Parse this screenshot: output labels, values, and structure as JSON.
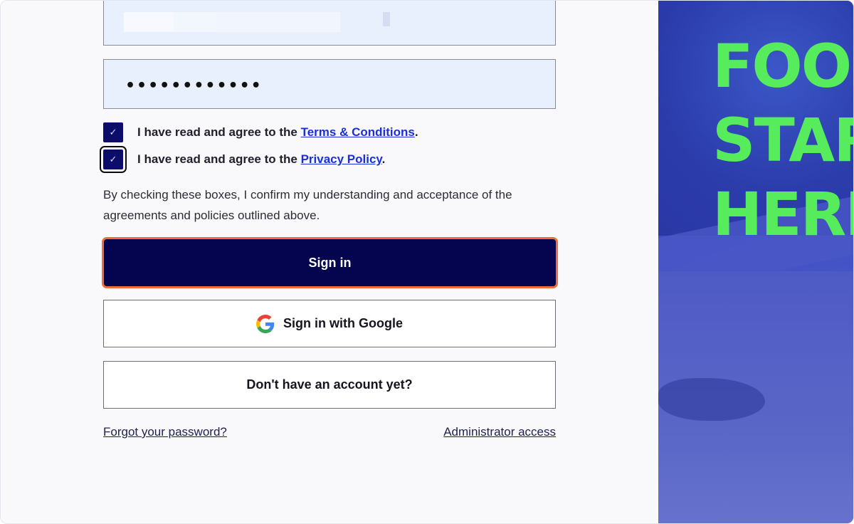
{
  "login": {
    "password_mask": "••••••••••••",
    "terms": {
      "prefix": "I have read and agree to the ",
      "link": "Terms & Conditions",
      "suffix": "."
    },
    "privacy": {
      "prefix": "I have read and agree to the ",
      "link": "Privacy Policy",
      "suffix": "."
    },
    "notice": "By checking these boxes, I confirm my understanding and acceptance of the agreements and policies outlined above.",
    "signin_label": "Sign in",
    "google_label": "Sign in with Google",
    "account_label": "Don't have an account yet?",
    "forgot_label": "Forgot your password?",
    "admin_label": "Administrator access"
  },
  "hero": {
    "line1": "FOO",
    "line2": "STAR",
    "line3": "HERI"
  },
  "colors": {
    "primary_button": "#04044f",
    "focus_ring": "#f26a3d",
    "hero_text": "#56ec5c",
    "link": "#1a2edc"
  }
}
